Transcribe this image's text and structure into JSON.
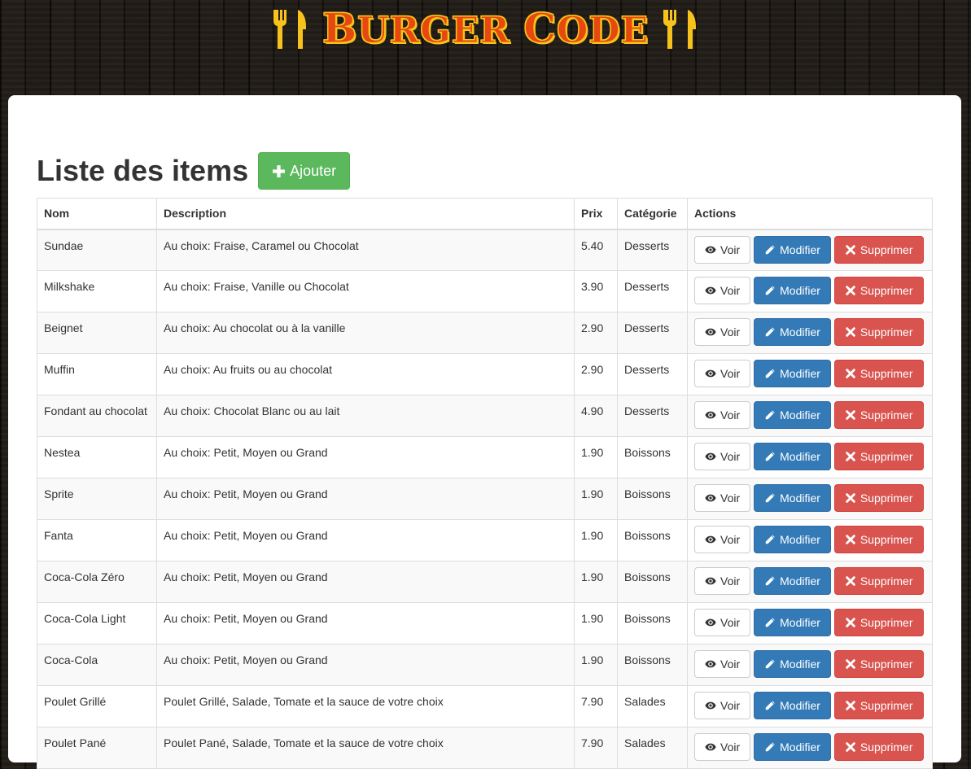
{
  "header": {
    "brand_first_letter": "B",
    "brand_word1_rest": "URGER",
    "brand_second_letter": "C",
    "brand_word2_rest": "ODE"
  },
  "page": {
    "title": "Liste des items",
    "add_label": "Ajouter"
  },
  "table": {
    "columns": [
      "Nom",
      "Description",
      "Prix",
      "Catégorie",
      "Actions"
    ],
    "actions": {
      "view": "Voir",
      "edit": "Modifier",
      "delete": "Supprimer"
    },
    "rows": [
      {
        "name": "Sundae",
        "description": "Au choix: Fraise, Caramel ou Chocolat",
        "price": "5.40",
        "category": "Desserts"
      },
      {
        "name": "Milkshake",
        "description": "Au choix: Fraise, Vanille ou Chocolat",
        "price": "3.90",
        "category": "Desserts"
      },
      {
        "name": "Beignet",
        "description": "Au choix: Au chocolat ou à la vanille",
        "price": "2.90",
        "category": "Desserts"
      },
      {
        "name": "Muffin",
        "description": "Au choix: Au fruits ou au chocolat",
        "price": "2.90",
        "category": "Desserts"
      },
      {
        "name": "Fondant au chocolat",
        "description": "Au choix: Chocolat Blanc ou au lait",
        "price": "4.90",
        "category": "Desserts"
      },
      {
        "name": "Nestea",
        "description": "Au choix: Petit, Moyen ou Grand",
        "price": "1.90",
        "category": "Boissons"
      },
      {
        "name": "Sprite",
        "description": "Au choix: Petit, Moyen ou Grand",
        "price": "1.90",
        "category": "Boissons"
      },
      {
        "name": "Fanta",
        "description": "Au choix: Petit, Moyen ou Grand",
        "price": "1.90",
        "category": "Boissons"
      },
      {
        "name": "Coca-Cola Zéro",
        "description": "Au choix: Petit, Moyen ou Grand",
        "price": "1.90",
        "category": "Boissons"
      },
      {
        "name": "Coca-Cola Light",
        "description": "Au choix: Petit, Moyen ou Grand",
        "price": "1.90",
        "category": "Boissons"
      },
      {
        "name": "Coca-Cola",
        "description": "Au choix: Petit, Moyen ou Grand",
        "price": "1.90",
        "category": "Boissons"
      },
      {
        "name": "Poulet Grillé",
        "description": "Poulet Grillé, Salade, Tomate et la sauce de votre choix",
        "price": "7.90",
        "category": "Salades"
      },
      {
        "name": "Poulet Pané",
        "description": "Poulet Pané, Salade, Tomate et la sauce de votre choix",
        "price": "7.90",
        "category": "Salades"
      }
    ]
  },
  "icons": {
    "logo": "fork-knife-icon",
    "add": "plus-icon",
    "view": "eye-icon",
    "edit": "pencil-icon",
    "delete": "remove-icon"
  },
  "colors": {
    "brand_red": "#e7480f",
    "brand_yellow": "#f6c21b",
    "success": "#5cb85c",
    "primary": "#337ab7",
    "danger": "#d9534f"
  }
}
